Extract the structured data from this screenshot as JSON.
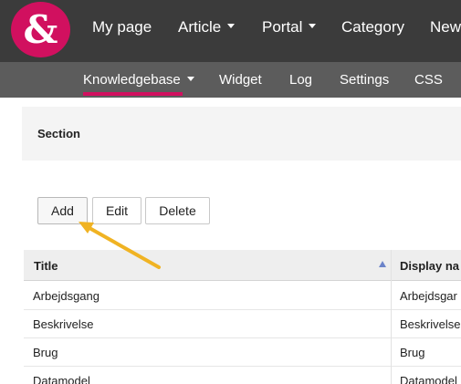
{
  "logo": {
    "glyph": "&",
    "color": "#d1105f"
  },
  "topnav": {
    "items": [
      {
        "label": "My page",
        "dropdown": false
      },
      {
        "label": "Article",
        "dropdown": true
      },
      {
        "label": "Portal",
        "dropdown": true
      },
      {
        "label": "Category",
        "dropdown": false
      },
      {
        "label": "New",
        "dropdown": false
      }
    ]
  },
  "subnav": {
    "items": [
      {
        "label": "Knowledgebase",
        "dropdown": true,
        "active": true
      },
      {
        "label": "Widget"
      },
      {
        "label": "Log"
      },
      {
        "label": "Settings"
      },
      {
        "label": "CSS"
      }
    ],
    "accent": "#d1105f"
  },
  "section": {
    "title": "Section"
  },
  "toolbar": {
    "add_label": "Add",
    "edit_label": "Edit",
    "delete_label": "Delete"
  },
  "table": {
    "columns": [
      "Title",
      "Display na"
    ],
    "sort": {
      "column": "Title",
      "direction": "ascending"
    },
    "rows": [
      [
        "Arbejdsgang",
        "Arbejdsgar"
      ],
      [
        "Beskrivelse",
        "Beskrivelse"
      ],
      [
        "Brug",
        "Brug"
      ],
      [
        "Datamodel",
        "Datamodel"
      ]
    ]
  },
  "annotation": {
    "type": "arrow",
    "color": "#f0b323",
    "points_to": "Add"
  }
}
